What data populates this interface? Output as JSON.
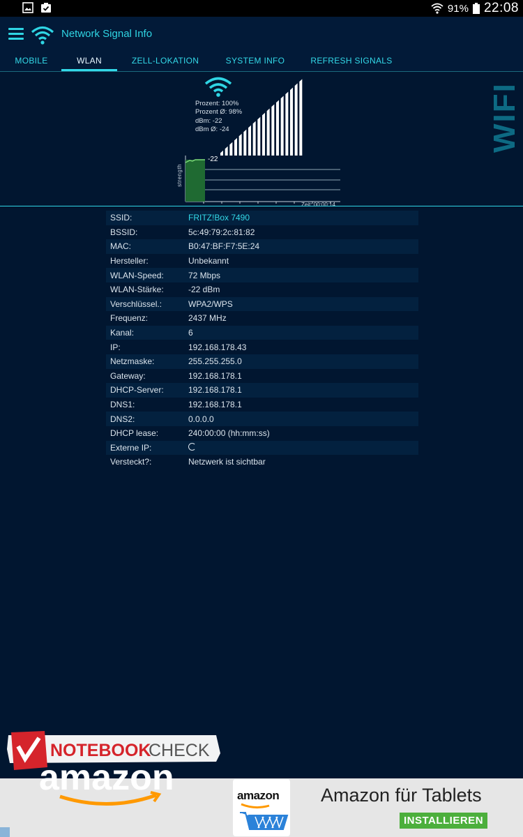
{
  "status_bar": {
    "battery": "91%",
    "time": "22:08"
  },
  "app_bar": {
    "title": "Network Signal Info"
  },
  "tabs": [
    {
      "label": "MOBILE"
    },
    {
      "label": "WLAN"
    },
    {
      "label": "ZELL-LOKATION"
    },
    {
      "label": "SYSTEM INFO"
    },
    {
      "label": "REFRESH SIGNALS"
    }
  ],
  "signal": {
    "stats": [
      "Prozent: 100%",
      "Prozent Ø: 98%",
      "dBm: -22",
      "dBm Ø: -24"
    ],
    "vertical_label": "WIFI",
    "level_fraction": 1.0,
    "graph_value": "-22",
    "graph_ylabel": "strength",
    "graph_xlabel": "Zeit: 00:00:14"
  },
  "info": [
    {
      "label": "SSID:",
      "value": "FRITZ!Box 7490",
      "accent": true
    },
    {
      "label": "BSSID:",
      "value": "5c:49:79:2c:81:82"
    },
    {
      "label": "MAC:",
      "value": "B0:47:BF:F7:5E:24"
    },
    {
      "label": "Hersteller:",
      "value": "Unbekannt"
    },
    {
      "label": "WLAN-Speed:",
      "value": "72 Mbps"
    },
    {
      "label": "WLAN-Stärke:",
      "value": "-22 dBm"
    },
    {
      "label": "Verschlüssel.:",
      "value": "WPA2/WPS"
    },
    {
      "label": "Frequenz:",
      "value": "2437 MHz"
    },
    {
      "label": "Kanal:",
      "value": "6"
    },
    {
      "label": "IP:",
      "value": "192.168.178.43"
    },
    {
      "label": "Netzmaske:",
      "value": "255.255.255.0"
    },
    {
      "label": "Gateway:",
      "value": "192.168.178.1"
    },
    {
      "label": "DHCP-Server:",
      "value": "192.168.178.1"
    },
    {
      "label": "DNS1:",
      "value": "192.168.178.1"
    },
    {
      "label": "DNS2:",
      "value": "0.0.0.0"
    },
    {
      "label": "DHCP lease:",
      "value": "240:00:00 (hh:mm:ss)"
    },
    {
      "label": "Externe IP:",
      "value": "",
      "loading": true
    },
    {
      "label": "Versteckt?:",
      "value": "Netzwerk ist sichtbar"
    }
  ],
  "watermark": {
    "text_bold": "NOTEBOOK",
    "text_light": "CHECK"
  },
  "ad": {
    "left_wordmark": "amazon",
    "card_text": "amazon",
    "title": "Amazon für Tablets",
    "install_label": "INSTALLIEREN"
  },
  "colors": {
    "accent": "#33d9e8",
    "background": "#011630",
    "install_green": "#4caf3c"
  }
}
